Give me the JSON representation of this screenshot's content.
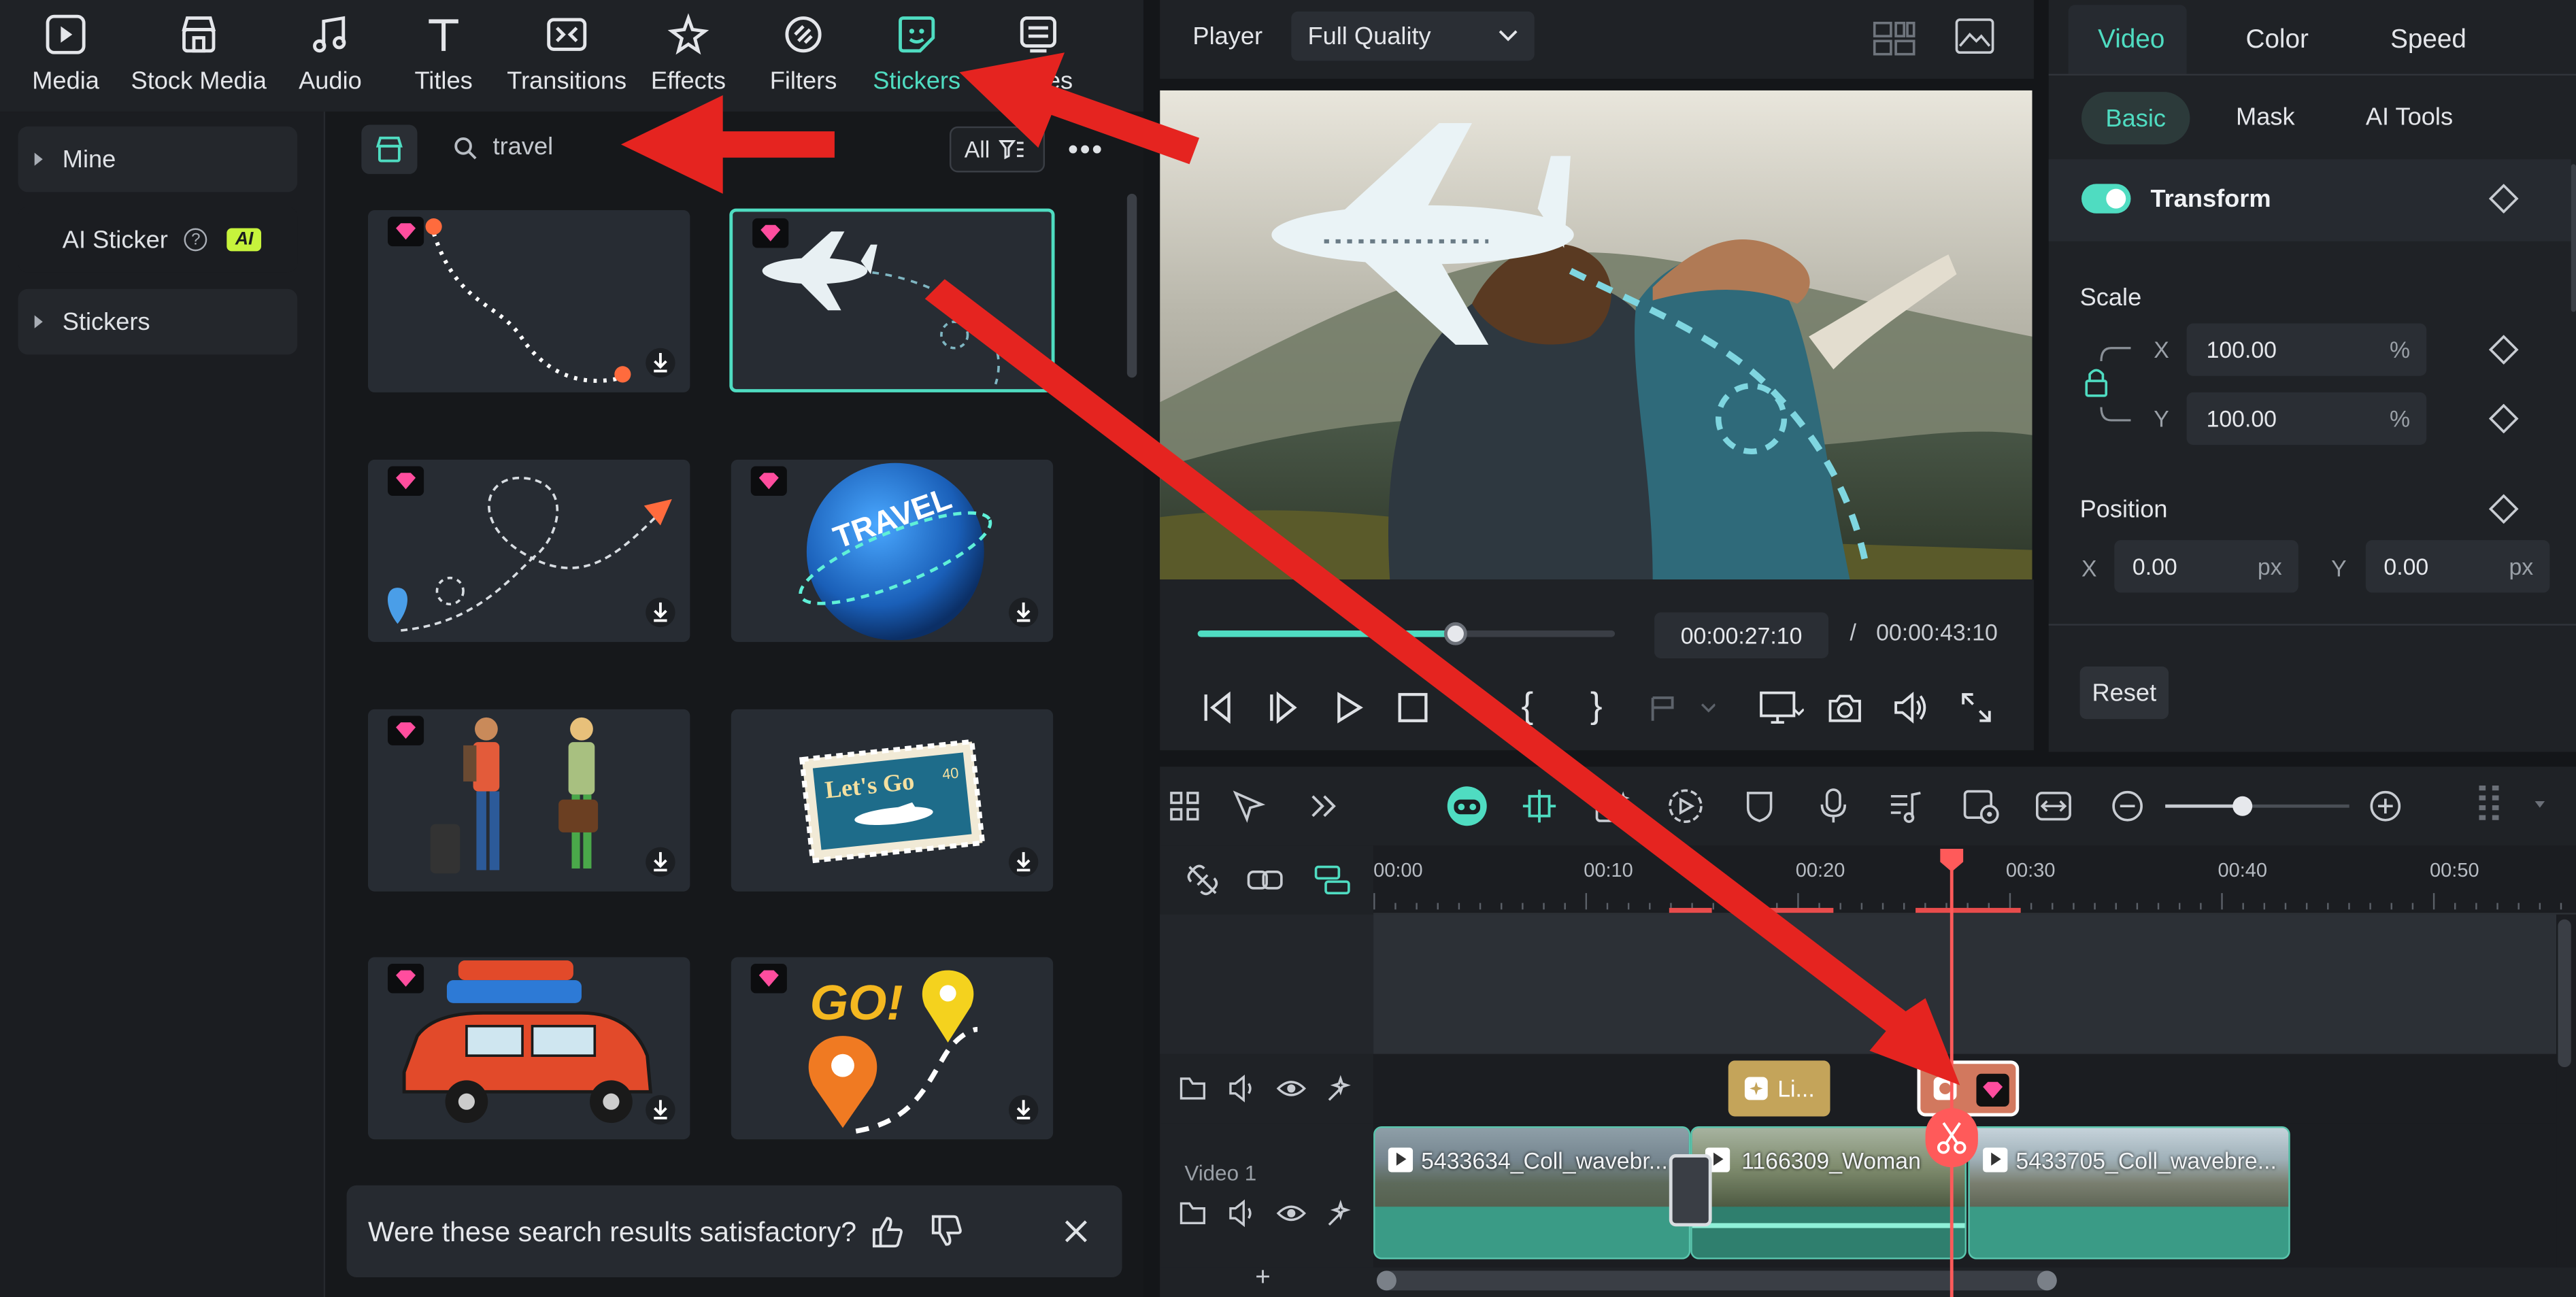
{
  "top_tabs": [
    {
      "label": "Media",
      "icon": "media-icon"
    },
    {
      "label": "Stock Media",
      "icon": "stock-media-icon"
    },
    {
      "label": "Audio",
      "icon": "music-note-icon"
    },
    {
      "label": "Titles",
      "icon": "text-t-icon"
    },
    {
      "label": "Transitions",
      "icon": "transitions-icon"
    },
    {
      "label": "Effects",
      "icon": "effects-star-icon"
    },
    {
      "label": "Filters",
      "icon": "filters-icon"
    },
    {
      "label": "Stickers",
      "icon": "sticker-icon",
      "active": true
    },
    {
      "label": "tes",
      "icon": "templates-icon"
    }
  ],
  "sidebar": {
    "items": [
      {
        "label": "Mine"
      },
      {
        "label": "AI Sticker",
        "badge": "AI"
      },
      {
        "label": "Stickers"
      }
    ]
  },
  "search": {
    "value": "travel",
    "filter_label": "All"
  },
  "feedback": {
    "question": "Were these search results satisfactory?"
  },
  "player": {
    "label": "Player",
    "quality": "Full Quality",
    "current_time": "00:00:27:10",
    "separator": "/",
    "total_time": "00:00:43:10",
    "progress": 0.62
  },
  "right_panel": {
    "tabs": [
      "Video",
      "Color",
      "Speed"
    ],
    "subtabs": [
      "Basic",
      "Mask",
      "AI Tools"
    ],
    "transform_label": "Transform",
    "scale_label": "Scale",
    "scale_x": {
      "axis": "X",
      "value": "100.00",
      "unit": "%"
    },
    "scale_y": {
      "axis": "Y",
      "value": "100.00",
      "unit": "%"
    },
    "position_label": "Position",
    "pos_x": {
      "axis": "X",
      "value": "0.00",
      "unit": "px"
    },
    "pos_y": {
      "axis": "Y",
      "value": "0.00",
      "unit": "px"
    },
    "reset_label": "Reset"
  },
  "timeline": {
    "ruler": [
      "00:00",
      "00:10",
      "00:20",
      "00:30",
      "00:40",
      "00:50"
    ],
    "track_label": "Video 1",
    "effect_clip_label": "Li...",
    "add_label": "+",
    "zoom_level": 0.42,
    "clips": [
      {
        "label": "5433634_Coll_wavebr..."
      },
      {
        "label": "1166309_Woman"
      },
      {
        "label": "5433705_Coll_wavebre..."
      }
    ]
  },
  "colors": {
    "accent": "#4fdcc1",
    "playhead": "#ff5a5a",
    "annotation_arrow": "#e52420"
  }
}
